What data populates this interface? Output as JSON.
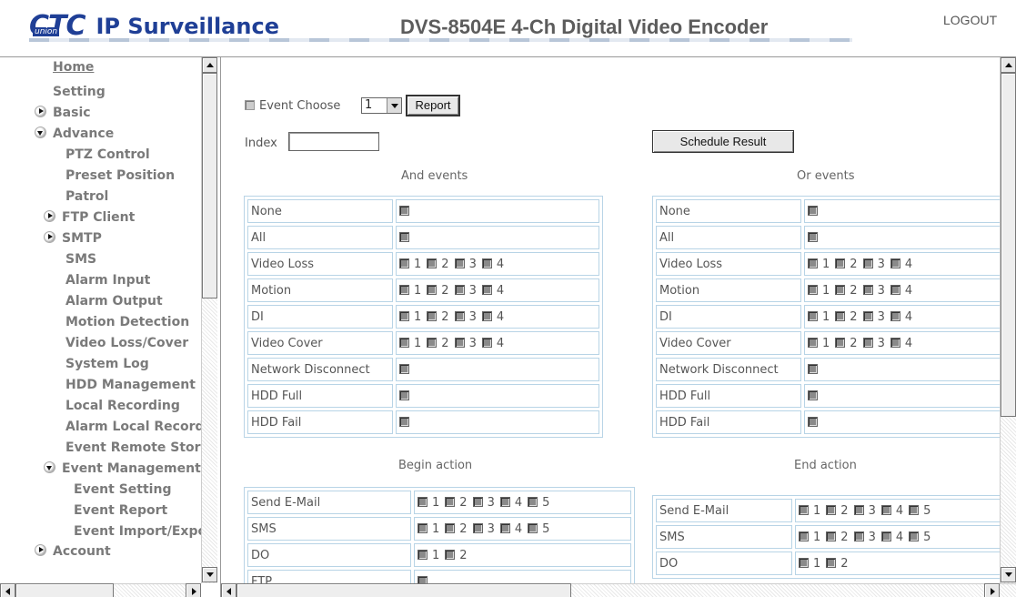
{
  "header": {
    "logo_mark": "CTC",
    "logo_sub": "union",
    "brand": "IP Surveillance",
    "device_title": "DVS-8504E 4-Ch Digital Video Encoder",
    "logout": "LOGOUT"
  },
  "sidebar": {
    "home": "Home",
    "setting": "Setting",
    "basic": "Basic",
    "advance": "Advance",
    "advance_items": [
      "PTZ Control",
      "Preset Position",
      "Patrol"
    ],
    "ftp_client": "FTP Client",
    "smtp": "SMTP",
    "items_after_smtp": [
      "SMS",
      "Alarm Input",
      "Alarm Output",
      "Motion Detection",
      "Video Loss/Cover",
      "System Log",
      "HDD Management",
      "Local Recording",
      "Alarm Local Recording",
      "Event Remote Storage"
    ],
    "event_management": "Event Management",
    "event_items": [
      "Event Setting",
      "Event Report",
      "Event Import/Export"
    ],
    "account": "Account"
  },
  "main": {
    "event_choose_label": "Event Choose",
    "event_choose_value": "1",
    "report_button": "Report",
    "index_label": "Index",
    "index_value": "",
    "schedule_result_button": "Schedule Result",
    "and_events_title": "And events",
    "or_events_title": "Or events",
    "begin_action_title": "Begin action",
    "end_action_title": "End action",
    "and_events": [
      {
        "label": "None",
        "boxes": []
      },
      {
        "label": "All",
        "boxes": []
      },
      {
        "label": "Video Loss",
        "boxes": [
          "1",
          "2",
          "3",
          "4"
        ]
      },
      {
        "label": "Motion",
        "boxes": [
          "1",
          "2",
          "3",
          "4"
        ]
      },
      {
        "label": "DI",
        "boxes": [
          "1",
          "2",
          "3",
          "4"
        ]
      },
      {
        "label": "Video Cover",
        "boxes": [
          "1",
          "2",
          "3",
          "4"
        ]
      },
      {
        "label": "Network Disconnect",
        "boxes": []
      },
      {
        "label": "HDD Full",
        "boxes": []
      },
      {
        "label": "HDD Fail",
        "boxes": []
      }
    ],
    "or_events": [
      {
        "label": "None",
        "boxes": []
      },
      {
        "label": "All",
        "boxes": []
      },
      {
        "label": "Video Loss",
        "boxes": [
          "1",
          "2",
          "3",
          "4"
        ]
      },
      {
        "label": "Motion",
        "boxes": [
          "1",
          "2",
          "3",
          "4"
        ]
      },
      {
        "label": "DI",
        "boxes": [
          "1",
          "2",
          "3",
          "4"
        ]
      },
      {
        "label": "Video Cover",
        "boxes": [
          "1",
          "2",
          "3",
          "4"
        ]
      },
      {
        "label": "Network Disconnect",
        "boxes": []
      },
      {
        "label": "HDD Full",
        "boxes": []
      },
      {
        "label": "HDD Fail",
        "boxes": []
      }
    ],
    "begin_action": [
      {
        "label": "Send E-Mail",
        "boxes": [
          "1",
          "2",
          "3",
          "4",
          "5"
        ]
      },
      {
        "label": "SMS",
        "boxes": [
          "1",
          "2",
          "3",
          "4",
          "5"
        ]
      },
      {
        "label": "DO",
        "boxes": [
          "1",
          "2"
        ]
      },
      {
        "label": "FTP",
        "boxes": []
      }
    ],
    "end_action": [
      {
        "label": "Send E-Mail",
        "boxes": [
          "1",
          "2",
          "3",
          "4",
          "5"
        ]
      },
      {
        "label": "SMS",
        "boxes": [
          "1",
          "2",
          "3",
          "4",
          "5"
        ]
      },
      {
        "label": "DO",
        "boxes": [
          "1",
          "2"
        ]
      }
    ]
  }
}
